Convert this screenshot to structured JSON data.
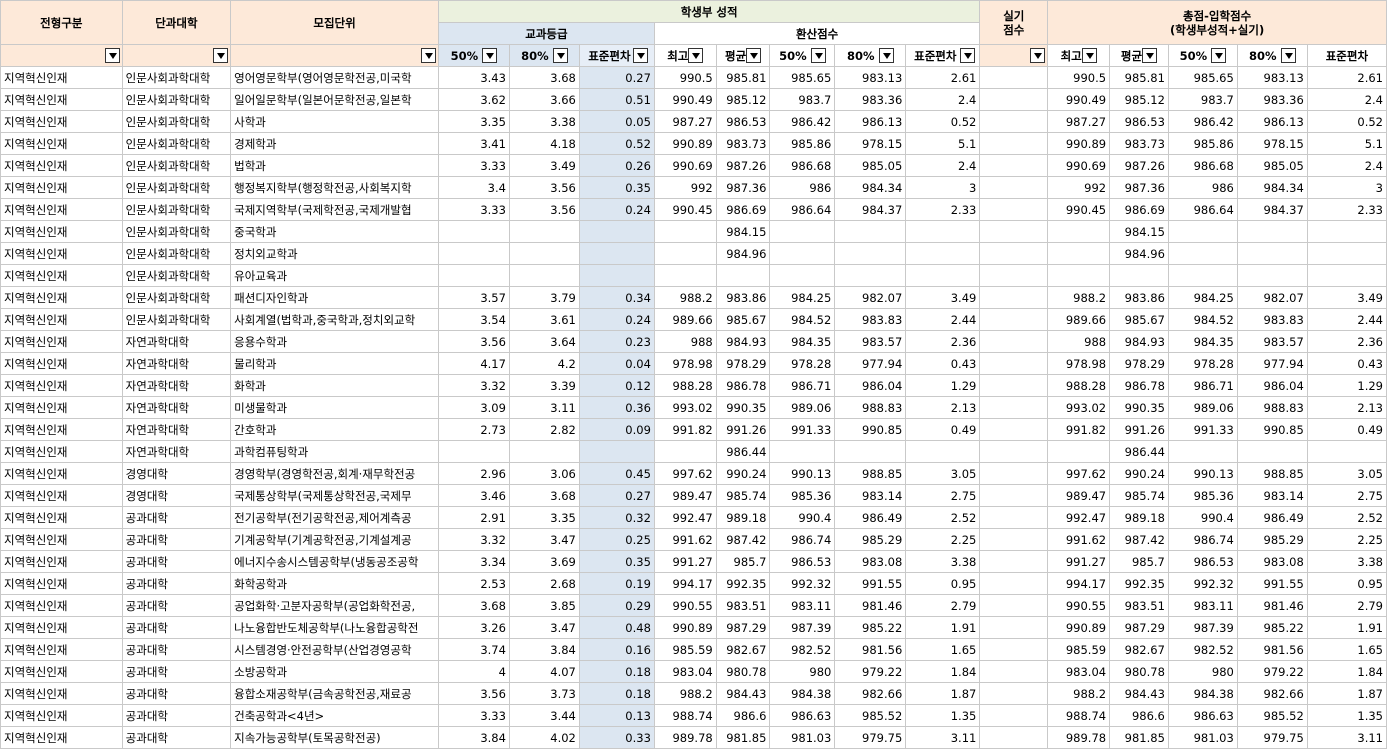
{
  "header": {
    "col_type": "전형구분",
    "col_college": "단과대학",
    "col_unit": "모집단위",
    "student_score": "학생부 성적",
    "grade": "교과등급",
    "converted": "환산점수",
    "practical_line1": "실기",
    "practical_line2": "점수",
    "total_line1": "총점-입학점수",
    "total_line2": "(학생부성적+실기)",
    "sub_grade": [
      "50%",
      "80%",
      "표준편차"
    ],
    "sub_conv": [
      "최고",
      "평균",
      "50%",
      "80%",
      "표준편차"
    ],
    "sub_total": [
      "최고",
      "평균",
      "50%",
      "80%",
      "표준편차"
    ]
  },
  "rows": [
    {
      "type": "지역혁신인재",
      "college": "인문사회과학대학",
      "unit": "영어영문학부(영어영문학전공,미국학",
      "g50": "3.43",
      "g80": "3.68",
      "gsd": "0.27",
      "cmax": "990.5",
      "cavg": "985.81",
      "c50": "985.65",
      "c80": "983.13",
      "csd": "2.61",
      "prac": "",
      "tmax": "990.5",
      "tavg": "985.81",
      "t50": "985.65",
      "t80": "983.13",
      "tsd": "2.61"
    },
    {
      "type": "지역혁신인재",
      "college": "인문사회과학대학",
      "unit": "일어일문학부(일본어문학전공,일본학",
      "g50": "3.62",
      "g80": "3.66",
      "gsd": "0.51",
      "cmax": "990.49",
      "cavg": "985.12",
      "c50": "983.7",
      "c80": "983.36",
      "csd": "2.4",
      "prac": "",
      "tmax": "990.49",
      "tavg": "985.12",
      "t50": "983.7",
      "t80": "983.36",
      "tsd": "2.4"
    },
    {
      "type": "지역혁신인재",
      "college": "인문사회과학대학",
      "unit": "사학과",
      "g50": "3.35",
      "g80": "3.38",
      "gsd": "0.05",
      "cmax": "987.27",
      "cavg": "986.53",
      "c50": "986.42",
      "c80": "986.13",
      "csd": "0.52",
      "prac": "",
      "tmax": "987.27",
      "tavg": "986.53",
      "t50": "986.42",
      "t80": "986.13",
      "tsd": "0.52"
    },
    {
      "type": "지역혁신인재",
      "college": "인문사회과학대학",
      "unit": "경제학과",
      "g50": "3.41",
      "g80": "4.18",
      "gsd": "0.52",
      "cmax": "990.89",
      "cavg": "983.73",
      "c50": "985.86",
      "c80": "978.15",
      "csd": "5.1",
      "prac": "",
      "tmax": "990.89",
      "tavg": "983.73",
      "t50": "985.86",
      "t80": "978.15",
      "tsd": "5.1"
    },
    {
      "type": "지역혁신인재",
      "college": "인문사회과학대학",
      "unit": "법학과",
      "g50": "3.33",
      "g80": "3.49",
      "gsd": "0.26",
      "cmax": "990.69",
      "cavg": "987.26",
      "c50": "986.68",
      "c80": "985.05",
      "csd": "2.4",
      "prac": "",
      "tmax": "990.69",
      "tavg": "987.26",
      "t50": "986.68",
      "t80": "985.05",
      "tsd": "2.4"
    },
    {
      "type": "지역혁신인재",
      "college": "인문사회과학대학",
      "unit": "행정복지학부(행정학전공,사회복지학",
      "g50": "3.4",
      "g80": "3.56",
      "gsd": "0.35",
      "cmax": "992",
      "cavg": "987.36",
      "c50": "986",
      "c80": "984.34",
      "csd": "3",
      "prac": "",
      "tmax": "992",
      "tavg": "987.36",
      "t50": "986",
      "t80": "984.34",
      "tsd": "3"
    },
    {
      "type": "지역혁신인재",
      "college": "인문사회과학대학",
      "unit": "국제지역학부(국제학전공,국제개발협",
      "g50": "3.33",
      "g80": "3.56",
      "gsd": "0.24",
      "cmax": "990.45",
      "cavg": "986.69",
      "c50": "986.64",
      "c80": "984.37",
      "csd": "2.33",
      "prac": "",
      "tmax": "990.45",
      "tavg": "986.69",
      "t50": "986.64",
      "t80": "984.37",
      "tsd": "2.33"
    },
    {
      "type": "지역혁신인재",
      "college": "인문사회과학대학",
      "unit": "중국학과",
      "g50": "",
      "g80": "",
      "gsd": "",
      "cmax": "",
      "cavg": "984.15",
      "c50": "",
      "c80": "",
      "csd": "",
      "prac": "",
      "tmax": "",
      "tavg": "984.15",
      "t50": "",
      "t80": "",
      "tsd": ""
    },
    {
      "type": "지역혁신인재",
      "college": "인문사회과학대학",
      "unit": "정치외교학과",
      "g50": "",
      "g80": "",
      "gsd": "",
      "cmax": "",
      "cavg": "984.96",
      "c50": "",
      "c80": "",
      "csd": "",
      "prac": "",
      "tmax": "",
      "tavg": "984.96",
      "t50": "",
      "t80": "",
      "tsd": ""
    },
    {
      "type": "지역혁신인재",
      "college": "인문사회과학대학",
      "unit": "유아교육과",
      "g50": "",
      "g80": "",
      "gsd": "",
      "cmax": "",
      "cavg": "",
      "c50": "",
      "c80": "",
      "csd": "",
      "prac": "",
      "tmax": "",
      "tavg": "",
      "t50": "",
      "t80": "",
      "tsd": ""
    },
    {
      "type": "지역혁신인재",
      "college": "인문사회과학대학",
      "unit": "패션디자인학과",
      "g50": "3.57",
      "g80": "3.79",
      "gsd": "0.34",
      "cmax": "988.2",
      "cavg": "983.86",
      "c50": "984.25",
      "c80": "982.07",
      "csd": "3.49",
      "prac": "",
      "tmax": "988.2",
      "tavg": "983.86",
      "t50": "984.25",
      "t80": "982.07",
      "tsd": "3.49"
    },
    {
      "type": "지역혁신인재",
      "college": "인문사회과학대학",
      "unit": "사회계열(법학과,중국학과,정치외교학",
      "g50": "3.54",
      "g80": "3.61",
      "gsd": "0.24",
      "cmax": "989.66",
      "cavg": "985.67",
      "c50": "984.52",
      "c80": "983.83",
      "csd": "2.44",
      "prac": "",
      "tmax": "989.66",
      "tavg": "985.67",
      "t50": "984.52",
      "t80": "983.83",
      "tsd": "2.44"
    },
    {
      "type": "지역혁신인재",
      "college": "자연과학대학",
      "unit": "응용수학과",
      "g50": "3.56",
      "g80": "3.64",
      "gsd": "0.23",
      "cmax": "988",
      "cavg": "984.93",
      "c50": "984.35",
      "c80": "983.57",
      "csd": "2.36",
      "prac": "",
      "tmax": "988",
      "tavg": "984.93",
      "t50": "984.35",
      "t80": "983.57",
      "tsd": "2.36"
    },
    {
      "type": "지역혁신인재",
      "college": "자연과학대학",
      "unit": "물리학과",
      "g50": "4.17",
      "g80": "4.2",
      "gsd": "0.04",
      "cmax": "978.98",
      "cavg": "978.29",
      "c50": "978.28",
      "c80": "977.94",
      "csd": "0.43",
      "prac": "",
      "tmax": "978.98",
      "tavg": "978.29",
      "t50": "978.28",
      "t80": "977.94",
      "tsd": "0.43"
    },
    {
      "type": "지역혁신인재",
      "college": "자연과학대학",
      "unit": "화학과",
      "g50": "3.32",
      "g80": "3.39",
      "gsd": "0.12",
      "cmax": "988.28",
      "cavg": "986.78",
      "c50": "986.71",
      "c80": "986.04",
      "csd": "1.29",
      "prac": "",
      "tmax": "988.28",
      "tavg": "986.78",
      "t50": "986.71",
      "t80": "986.04",
      "tsd": "1.29"
    },
    {
      "type": "지역혁신인재",
      "college": "자연과학대학",
      "unit": "미생물학과",
      "g50": "3.09",
      "g80": "3.11",
      "gsd": "0.36",
      "cmax": "993.02",
      "cavg": "990.35",
      "c50": "989.06",
      "c80": "988.83",
      "csd": "2.13",
      "prac": "",
      "tmax": "993.02",
      "tavg": "990.35",
      "t50": "989.06",
      "t80": "988.83",
      "tsd": "2.13"
    },
    {
      "type": "지역혁신인재",
      "college": "자연과학대학",
      "unit": "간호학과",
      "g50": "2.73",
      "g80": "2.82",
      "gsd": "0.09",
      "cmax": "991.82",
      "cavg": "991.26",
      "c50": "991.33",
      "c80": "990.85",
      "csd": "0.49",
      "prac": "",
      "tmax": "991.82",
      "tavg": "991.26",
      "t50": "991.33",
      "t80": "990.85",
      "tsd": "0.49"
    },
    {
      "type": "지역혁신인재",
      "college": "자연과학대학",
      "unit": "과학컴퓨팅학과",
      "g50": "",
      "g80": "",
      "gsd": "",
      "cmax": "",
      "cavg": "986.44",
      "c50": "",
      "c80": "",
      "csd": "",
      "prac": "",
      "tmax": "",
      "tavg": "986.44",
      "t50": "",
      "t80": "",
      "tsd": ""
    },
    {
      "type": "지역혁신인재",
      "college": "경영대학",
      "unit": "경영학부(경영학전공,회계·재무학전공",
      "g50": "2.96",
      "g80": "3.06",
      "gsd": "0.45",
      "cmax": "997.62",
      "cavg": "990.24",
      "c50": "990.13",
      "c80": "988.85",
      "csd": "3.05",
      "prac": "",
      "tmax": "997.62",
      "tavg": "990.24",
      "t50": "990.13",
      "t80": "988.85",
      "tsd": "3.05"
    },
    {
      "type": "지역혁신인재",
      "college": "경영대학",
      "unit": "국제통상학부(국제통상학전공,국제무",
      "g50": "3.46",
      "g80": "3.68",
      "gsd": "0.27",
      "cmax": "989.47",
      "cavg": "985.74",
      "c50": "985.36",
      "c80": "983.14",
      "csd": "2.75",
      "prac": "",
      "tmax": "989.47",
      "tavg": "985.74",
      "t50": "985.36",
      "t80": "983.14",
      "tsd": "2.75"
    },
    {
      "type": "지역혁신인재",
      "college": "공과대학",
      "unit": "전기공학부(전기공학전공,제어계측공",
      "g50": "2.91",
      "g80": "3.35",
      "gsd": "0.32",
      "cmax": "992.47",
      "cavg": "989.18",
      "c50": "990.4",
      "c80": "986.49",
      "csd": "2.52",
      "prac": "",
      "tmax": "992.47",
      "tavg": "989.18",
      "t50": "990.4",
      "t80": "986.49",
      "tsd": "2.52"
    },
    {
      "type": "지역혁신인재",
      "college": "공과대학",
      "unit": "기계공학부(기계공학전공,기계설계공",
      "g50": "3.32",
      "g80": "3.47",
      "gsd": "0.25",
      "cmax": "991.62",
      "cavg": "987.42",
      "c50": "986.74",
      "c80": "985.29",
      "csd": "2.25",
      "prac": "",
      "tmax": "991.62",
      "tavg": "987.42",
      "t50": "986.74",
      "t80": "985.29",
      "tsd": "2.25"
    },
    {
      "type": "지역혁신인재",
      "college": "공과대학",
      "unit": "에너지수송시스템공학부(냉동공조공학",
      "g50": "3.34",
      "g80": "3.69",
      "gsd": "0.35",
      "cmax": "991.27",
      "cavg": "985.7",
      "c50": "986.53",
      "c80": "983.08",
      "csd": "3.38",
      "prac": "",
      "tmax": "991.27",
      "tavg": "985.7",
      "t50": "986.53",
      "t80": "983.08",
      "tsd": "3.38"
    },
    {
      "type": "지역혁신인재",
      "college": "공과대학",
      "unit": "화학공학과",
      "g50": "2.53",
      "g80": "2.68",
      "gsd": "0.19",
      "cmax": "994.17",
      "cavg": "992.35",
      "c50": "992.32",
      "c80": "991.55",
      "csd": "0.95",
      "prac": "",
      "tmax": "994.17",
      "tavg": "992.35",
      "t50": "992.32",
      "t80": "991.55",
      "tsd": "0.95"
    },
    {
      "type": "지역혁신인재",
      "college": "공과대학",
      "unit": "공업화학·고분자공학부(공업화학전공,",
      "g50": "3.68",
      "g80": "3.85",
      "gsd": "0.29",
      "cmax": "990.55",
      "cavg": "983.51",
      "c50": "983.11",
      "c80": "981.46",
      "csd": "2.79",
      "prac": "",
      "tmax": "990.55",
      "tavg": "983.51",
      "t50": "983.11",
      "t80": "981.46",
      "tsd": "2.79"
    },
    {
      "type": "지역혁신인재",
      "college": "공과대학",
      "unit": "나노융합반도체공학부(나노융합공학전",
      "g50": "3.26",
      "g80": "3.47",
      "gsd": "0.48",
      "cmax": "990.89",
      "cavg": "987.29",
      "c50": "987.39",
      "c80": "985.22",
      "csd": "1.91",
      "prac": "",
      "tmax": "990.89",
      "tavg": "987.29",
      "t50": "987.39",
      "t80": "985.22",
      "tsd": "1.91"
    },
    {
      "type": "지역혁신인재",
      "college": "공과대학",
      "unit": "시스템경영·안전공학부(산업경영공학",
      "g50": "3.74",
      "g80": "3.84",
      "gsd": "0.16",
      "cmax": "985.59",
      "cavg": "982.67",
      "c50": "982.52",
      "c80": "981.56",
      "csd": "1.65",
      "prac": "",
      "tmax": "985.59",
      "tavg": "982.67",
      "t50": "982.52",
      "t80": "981.56",
      "tsd": "1.65"
    },
    {
      "type": "지역혁신인재",
      "college": "공과대학",
      "unit": "소방공학과",
      "g50": "4",
      "g80": "4.07",
      "gsd": "0.18",
      "cmax": "983.04",
      "cavg": "980.78",
      "c50": "980",
      "c80": "979.22",
      "csd": "1.84",
      "prac": "",
      "tmax": "983.04",
      "tavg": "980.78",
      "t50": "980",
      "t80": "979.22",
      "tsd": "1.84"
    },
    {
      "type": "지역혁신인재",
      "college": "공과대학",
      "unit": "융합소재공학부(금속공학전공,재료공",
      "g50": "3.56",
      "g80": "3.73",
      "gsd": "0.18",
      "cmax": "988.2",
      "cavg": "984.43",
      "c50": "984.38",
      "c80": "982.66",
      "csd": "1.87",
      "prac": "",
      "tmax": "988.2",
      "tavg": "984.43",
      "t50": "984.38",
      "t80": "982.66",
      "tsd": "1.87"
    },
    {
      "type": "지역혁신인재",
      "college": "공과대학",
      "unit": "건축공학과<4년>",
      "g50": "3.33",
      "g80": "3.44",
      "gsd": "0.13",
      "cmax": "988.74",
      "cavg": "986.6",
      "c50": "986.63",
      "c80": "985.52",
      "csd": "1.35",
      "prac": "",
      "tmax": "988.74",
      "tavg": "986.6",
      "t50": "986.63",
      "t80": "985.52",
      "tsd": "1.35"
    },
    {
      "type": "지역혁신인재",
      "college": "공과대학",
      "unit": "지속가능공학부(토목공학전공)",
      "g50": "3.84",
      "g80": "4.02",
      "gsd": "0.33",
      "cmax": "989.78",
      "cavg": "981.85",
      "c50": "981.03",
      "c80": "979.75",
      "csd": "3.11",
      "prac": "",
      "tmax": "989.78",
      "tavg": "981.85",
      "t50": "981.03",
      "t80": "979.75",
      "tsd": "3.11"
    }
  ]
}
